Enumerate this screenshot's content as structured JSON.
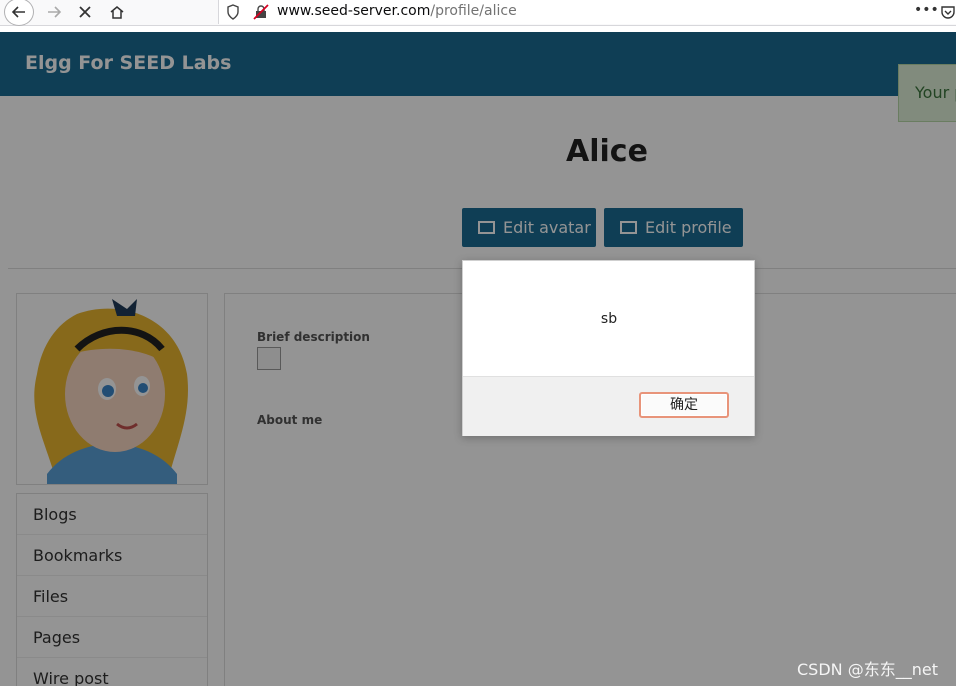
{
  "browser": {
    "url_host": "www.seed-server.com",
    "url_path": "/profile/alice"
  },
  "header": {
    "site_title": "Elgg For SEED Labs"
  },
  "notice": {
    "text": "Your p"
  },
  "profile": {
    "name": "Alice",
    "edit_avatar_label": "Edit avatar",
    "edit_profile_label": "Edit profile",
    "brief_description_label": "Brief description",
    "about_me_label": "About me"
  },
  "sidebar": {
    "items": [
      {
        "label": "Blogs"
      },
      {
        "label": "Bookmarks"
      },
      {
        "label": "Files"
      },
      {
        "label": "Pages"
      },
      {
        "label": "Wire post"
      }
    ]
  },
  "dialog": {
    "message": "sb",
    "ok_label": "确定"
  },
  "watermark": "CSDN @东东__net",
  "colors": {
    "header_bg": "#1a6b93",
    "button_bg": "#1a6b93",
    "notice_bg": "#dff0d8"
  }
}
